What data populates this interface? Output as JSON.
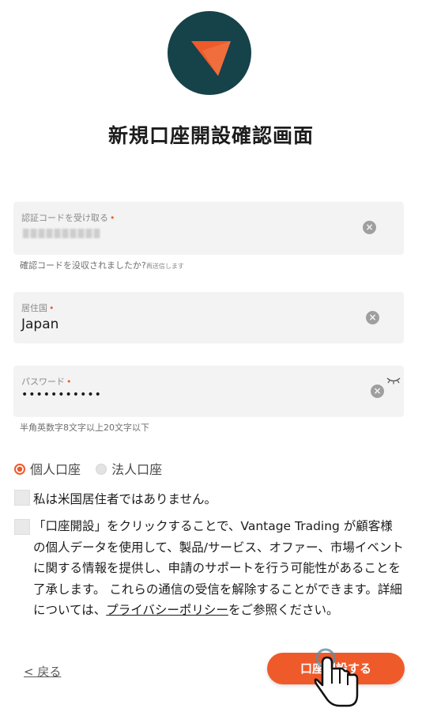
{
  "colors": {
    "brand_dark": "#16424a",
    "accent": "#ef5a2b"
  },
  "page_title": "新規口座開設確認画面",
  "fields": {
    "verify_code": {
      "label": "認証コードを受け取る",
      "required_mark": "•",
      "clear_icon": "clear-icon"
    },
    "verify_hint": {
      "text": "確認コードを没収されましたか?",
      "small": "再送信します"
    },
    "country": {
      "label": "居住国",
      "required_mark": "•",
      "value": "Japan",
      "clear_icon": "clear-icon"
    },
    "password": {
      "label": "パスワード",
      "required_mark": "•",
      "value": "•••••••••••",
      "toggle_icon": "eye-closed-icon"
    },
    "password_hint": "半角英数字8文字以上20文字以下"
  },
  "account_type": {
    "options": [
      {
        "label": "個人口座",
        "selected": true
      },
      {
        "label": "法人口座",
        "selected": false
      }
    ]
  },
  "checkboxes": {
    "us_resident": "私は米国居住者ではありません。",
    "consent_text": "「口座開設」をクリックすることで、Vantage Trading が顧客様の個人データを使用して、製品/サービス、オファー、市場イベントに関する情報を提供し、申請のサポートを行う可能性があることを了承します。 これらの通信の受信を解除することができます。詳細については、",
    "consent_link": "プライバシーポリシー",
    "consent_suffix": "をご参照ください。"
  },
  "actions": {
    "back_label": "< 戻る",
    "submit_label": "口座開設する"
  }
}
